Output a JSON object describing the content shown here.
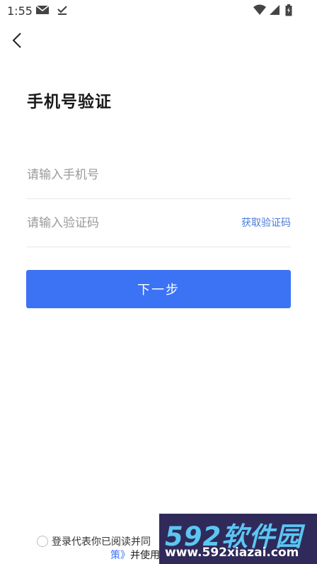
{
  "status_bar": {
    "time": "1:55",
    "icons": [
      "mail-icon",
      "download-done-icon",
      "wifi-icon",
      "signal-icon",
      "battery-icon"
    ]
  },
  "header": {
    "back_icon": "chevron-left-icon"
  },
  "page": {
    "title": "手机号验证"
  },
  "form": {
    "phone_placeholder": "请输入手机号",
    "code_placeholder": "请输入验证码",
    "get_code_label": "获取验证码",
    "next_label": "下一步"
  },
  "agreement": {
    "line1": "登录代表你已阅读并同",
    "line2_link": "策》",
    "line2_text": "并使用"
  },
  "watermark": {
    "brand": "592软件园",
    "url": "www.592xiazai.com"
  },
  "colors": {
    "accent": "#3c73f5",
    "link": "#4b7bd8",
    "divider": "#e8e8e8"
  }
}
